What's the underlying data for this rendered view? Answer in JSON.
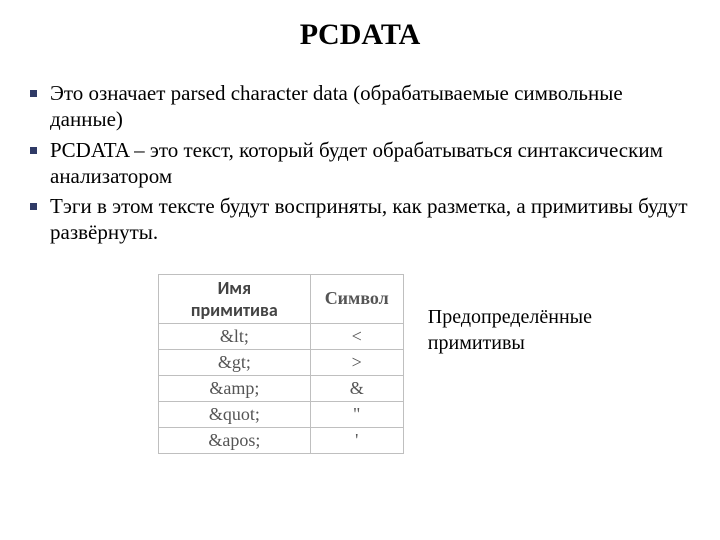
{
  "title": "PCDATA",
  "bullets": [
    "Это означает parsed character data (обрабатываемые символьные данные)",
    "PCDATA – это текст, который будет обрабатываться синтаксическим анализатором",
    "Тэги в этом тексте будут восприняты, как разметка, а примитивы будут развёрнуты."
  ],
  "table": {
    "headers": [
      "Имя примитива",
      "Символ"
    ],
    "rows": [
      [
        "&lt;",
        "<"
      ],
      [
        "&gt;",
        ">"
      ],
      [
        "&amp;",
        "&"
      ],
      [
        "&quot;",
        "\""
      ],
      [
        "&apos;",
        "'"
      ]
    ]
  },
  "caption": "Предопределённые примитивы"
}
